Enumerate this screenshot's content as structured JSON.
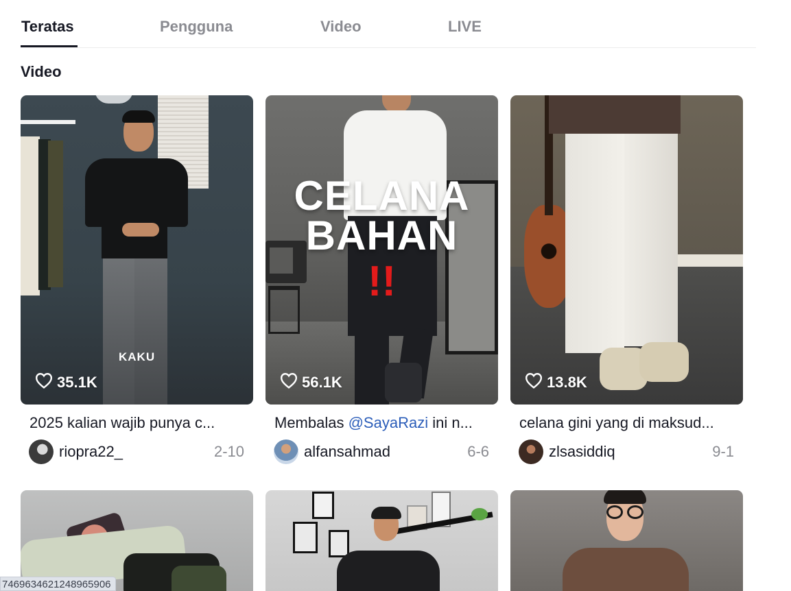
{
  "tabs": [
    {
      "label": "Teratas",
      "active": true
    },
    {
      "label": "Pengguna",
      "active": false
    },
    {
      "label": "Video",
      "active": false
    },
    {
      "label": "LIVE",
      "active": false
    }
  ],
  "section_title": "Video",
  "videos": [
    {
      "likes": "35.1K",
      "caption": "2025 kalian wajib punya c...",
      "username": "riopra22_",
      "date": "2-10",
      "overlay_text": "KAKU"
    },
    {
      "likes": "56.1K",
      "caption_prefix": "Membalas ",
      "caption_mention": "@SayaRazi",
      "caption_suffix": " ini n...",
      "username": "alfansahmad",
      "date": "6-6",
      "overlay_line1": "CELANA",
      "overlay_line2": "BAHAN",
      "overlay_mark": "!!"
    },
    {
      "likes": "13.8K",
      "caption": "celana gini yang di maksud...",
      "username": "zlsasiddiq",
      "date": "9-1"
    }
  ],
  "status_url": "7469634621248965906",
  "colors": {
    "text_primary": "#161823",
    "text_secondary": "#8a8b91",
    "mention": "#2b5db9",
    "warning": "#e31b1b"
  },
  "icons": {
    "likes": "heart-outline-icon"
  }
}
